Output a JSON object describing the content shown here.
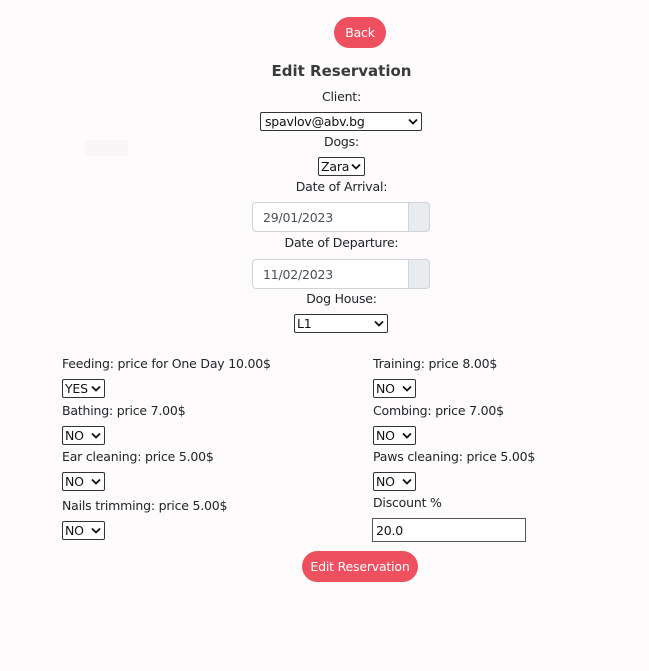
{
  "buttons": {
    "back": "Back",
    "submit": "Edit Reservation"
  },
  "title": "Edit Reservation",
  "client": {
    "label": "Client:",
    "value": "spavlov@abv.bg"
  },
  "dogs": {
    "label": "Dogs:",
    "value": "Zara"
  },
  "arrival": {
    "label": "Date of Arrival:",
    "value": "29/01/2023"
  },
  "departure": {
    "label": "Date of Departure:",
    "value": "11/02/2023"
  },
  "dog_house": {
    "label": "Dog House:",
    "value": "L1"
  },
  "services": {
    "feeding": {
      "label": "Feeding: price for One Day 10.00$",
      "value": "YES"
    },
    "training": {
      "label": "Training: price 8.00$",
      "value": "NO"
    },
    "bathing": {
      "label": "Bathing: price 7.00$",
      "value": "NO"
    },
    "combing": {
      "label": "Combing: price 7.00$",
      "value": "NO"
    },
    "ear_cleaning": {
      "label": "Ear cleaning: price 5.00$",
      "value": "NO"
    },
    "paws_cleaning": {
      "label": "Paws cleaning: price 5.00$",
      "value": "NO"
    },
    "nails_trimming": {
      "label": "Nails trimming: price 5.00$",
      "value": "NO"
    }
  },
  "discount": {
    "label": "Discount %",
    "value": "20.0"
  },
  "colors": {
    "accent": "#ef5060",
    "background": "#fdfbfb"
  },
  "icons": {
    "select_arrow": "chevron-down-icon"
  }
}
